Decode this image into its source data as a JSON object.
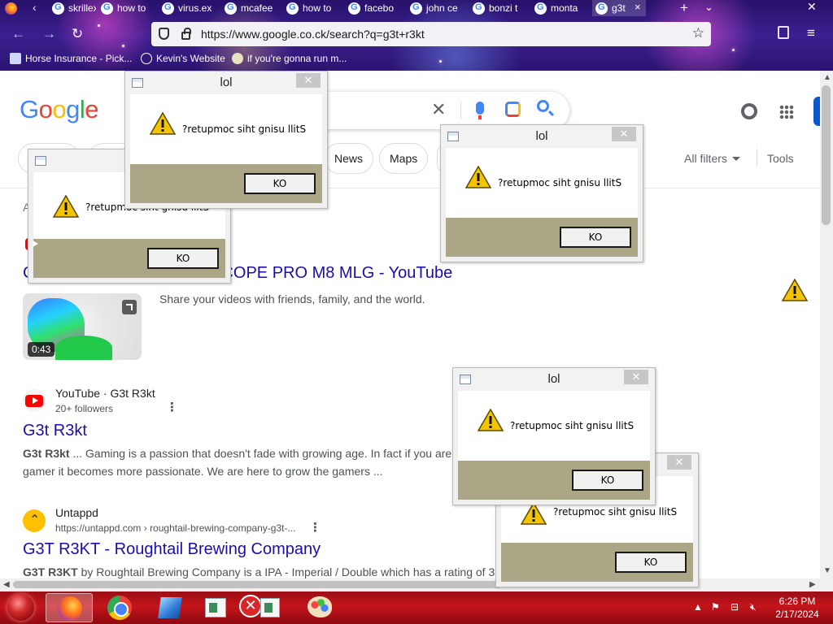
{
  "browser": {
    "tabs": [
      {
        "label": "skrillex"
      },
      {
        "label": "how to"
      },
      {
        "label": "virus.ex"
      },
      {
        "label": "mcafee"
      },
      {
        "label": "how to"
      },
      {
        "label": "facebo"
      },
      {
        "label": "john ce"
      },
      {
        "label": "bonzi t"
      },
      {
        "label": "monta"
      },
      {
        "label": "g3t"
      }
    ],
    "url": "https://www.google.co.ck/search?q=g3t+r3kt",
    "bookmarks": [
      {
        "label": "Horse Insurance - Pick..."
      },
      {
        "label": "Kevin's Website"
      },
      {
        "label": "if you're gonna run m..."
      }
    ]
  },
  "google": {
    "logo_letters": [
      "G",
      "o",
      "o",
      "g",
      "l",
      "e"
    ],
    "chips": [
      {
        "label": "News"
      },
      {
        "label": "Maps"
      }
    ],
    "all_filters": "All filters",
    "tools": "Tools",
    "about_fragment": "A",
    "results": [
      {
        "title_visible": "COPE PRO M8 MLG - YouTube",
        "title_lead": "C",
        "snippet": "Share your videos with friends, family, and the world.",
        "duration": "0:43"
      },
      {
        "site": "YouTube",
        "site_sep": "·",
        "channel": "G3t R3kt",
        "followers": "20+ followers",
        "title": "G3t R3kt",
        "snippet_bold": "G3t R3kt",
        "snippet_line1": " ... Gaming is a passion that doesn't fade with growing age. In fact if you are",
        "snippet_line2": "gamer it becomes more passionate. We are here to grow the gamers ..."
      },
      {
        "site": "Untappd",
        "url": "https://untappd.com › roughtail-brewing-company-g3t-...",
        "title": "G3T R3KT - Roughtail Brewing Company",
        "snippet_bold": "G3T R3KT",
        "snippet": " by Roughtail Brewing Company is a IPA - Imperial / Double which has a rating of 3"
      }
    ]
  },
  "dialogs": [
    {
      "title": "lol",
      "message": "?retupmoc siht gnisu llitS",
      "button": "KO"
    },
    {
      "title": "",
      "message": "?retupmoc siht gnisu llitS",
      "button": "KO"
    },
    {
      "title": "lol",
      "message": "?retupmoc siht gnisu llitS",
      "button": "KO"
    },
    {
      "title": "lol",
      "message": "?retupmoc siht gnisu llitS",
      "button": "KO"
    },
    {
      "title": "",
      "message": "?retupmoc siht gnisu llitS",
      "button": "KO"
    }
  ],
  "taskbar": {
    "time": "6:26 PM",
    "date": "2/17/2024"
  },
  "icons": {
    "warning": "warning-triangle",
    "close": "x"
  }
}
